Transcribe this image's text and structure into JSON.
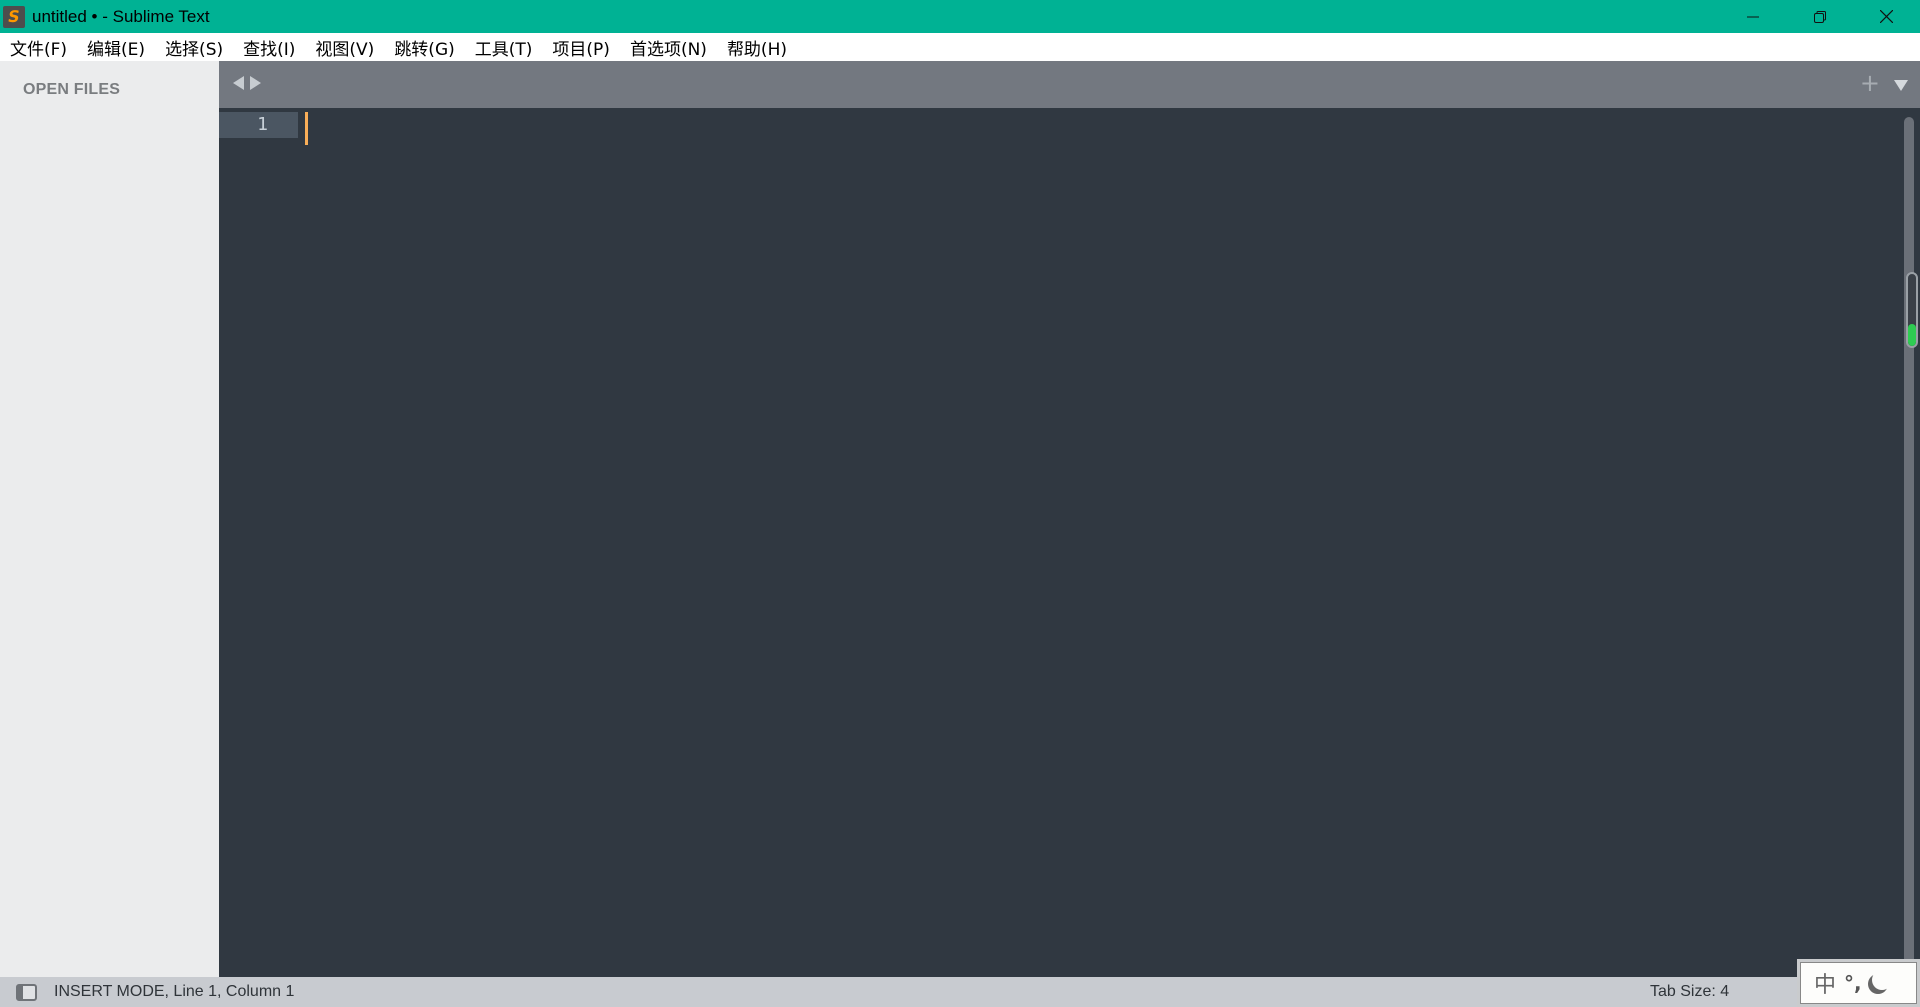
{
  "window": {
    "title": "untitled • - Sublime Text",
    "app_icon": "sublime-text-logo",
    "app_icon_glyph": "S",
    "controls": {
      "minimize_glyph": "—",
      "restore_glyph": "❐",
      "close_glyph": "✕"
    },
    "colors": {
      "titlebar": "#00b294",
      "editor_bg": "#303841",
      "caret": "#f9ae58",
      "sidebar_bg": "#ebeced",
      "tabbar_bg": "#737880",
      "statusbar_bg": "#c8cbd0"
    }
  },
  "menu": {
    "items": [
      {
        "label": "文件(F)"
      },
      {
        "label": "编辑(E)"
      },
      {
        "label": "选择(S)"
      },
      {
        "label": "查找(I)"
      },
      {
        "label": "视图(V)"
      },
      {
        "label": "跳转(G)"
      },
      {
        "label": "工具(T)"
      },
      {
        "label": "项目(P)"
      },
      {
        "label": "首选项(N)"
      },
      {
        "label": "帮助(H)"
      }
    ]
  },
  "sidebar": {
    "heading": "OPEN FILES"
  },
  "tabbar": {
    "new_tab_glyph": "+"
  },
  "editor": {
    "line_numbers": [
      "1"
    ],
    "content": ""
  },
  "scrollbar": {
    "indicator_fill": 0.3
  },
  "statusbar": {
    "mode_text": "INSERT MODE, Line 1, Column 1",
    "tab_size": "Tab Size: 4"
  },
  "ime_toolbar": {
    "language": "中",
    "punctuation": "°,",
    "width_mode_icon": "half-width-moon"
  }
}
